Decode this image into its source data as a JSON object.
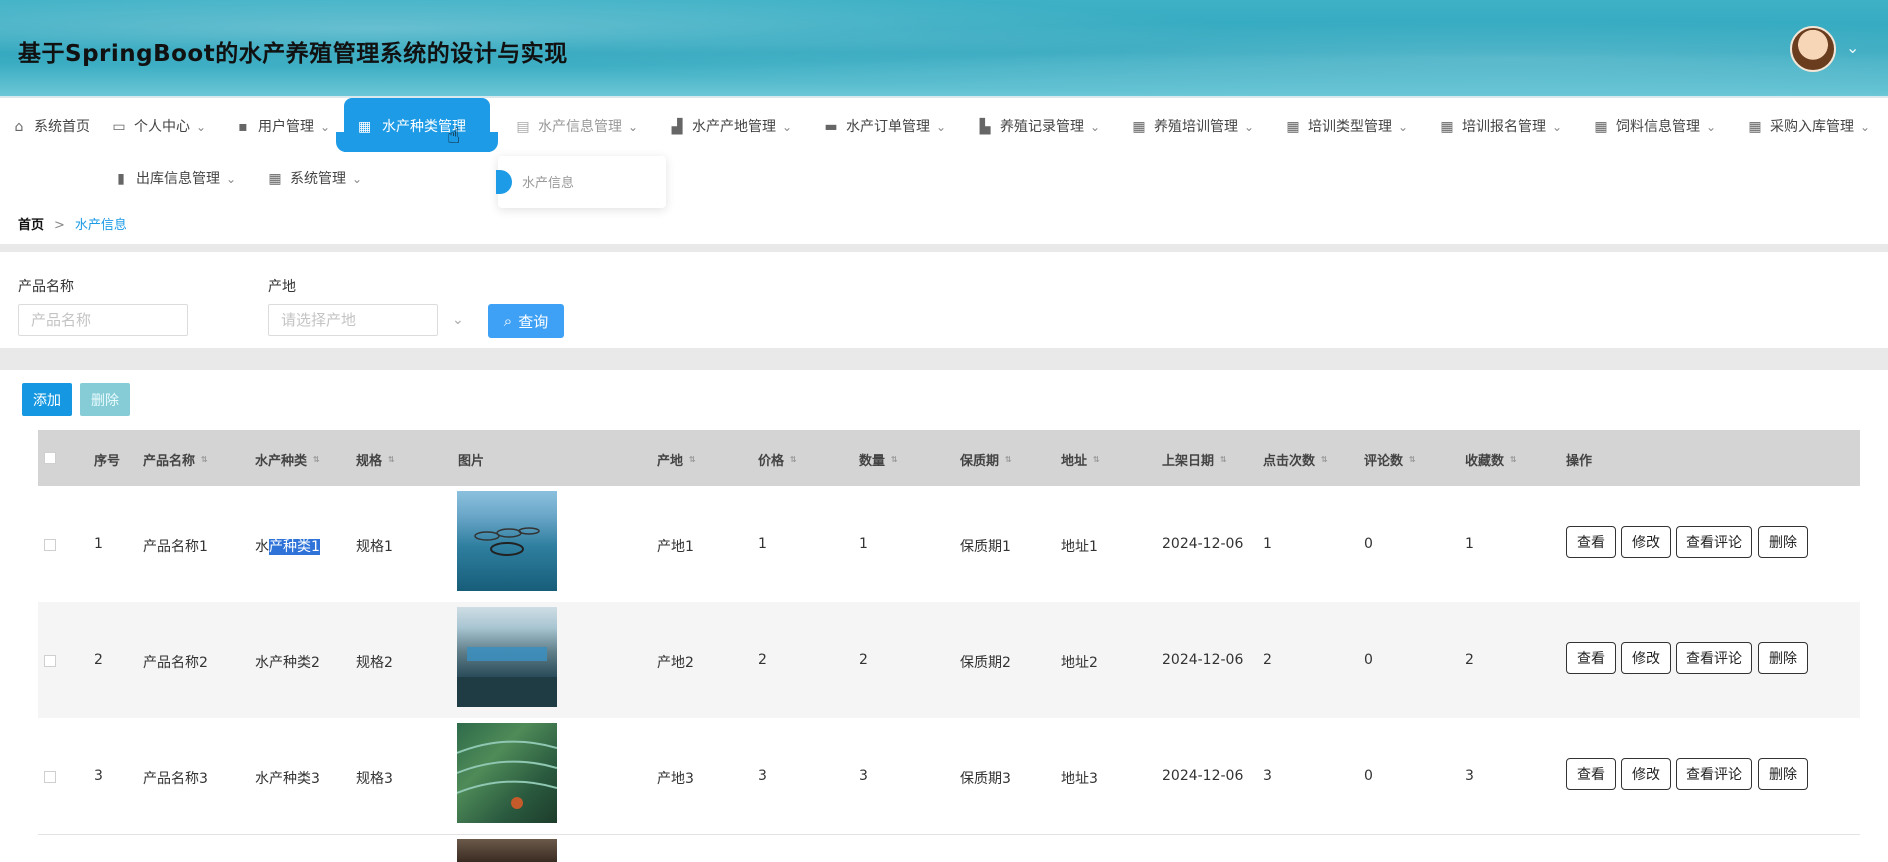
{
  "app": {
    "title": "基于SpringBoot的水产养殖管理系统的设计与实现",
    "user_menu_caret": "⌄"
  },
  "nav": {
    "items": [
      {
        "label": "系统首页",
        "icon": "home-icon"
      },
      {
        "label": "个人中心",
        "icon": "profile-icon"
      },
      {
        "label": "用户管理",
        "icon": "chat-icon"
      },
      {
        "label": "水产种类管理",
        "icon": "grid-icon",
        "active": true
      },
      {
        "label": "水产信息管理",
        "icon": "clipboard-icon"
      },
      {
        "label": "水产产地管理",
        "icon": "factory-icon"
      },
      {
        "label": "水产订单管理",
        "icon": "briefcase-icon"
      },
      {
        "label": "养殖记录管理",
        "icon": "building-icon"
      },
      {
        "label": "养殖培训管理",
        "icon": "grid-icon"
      },
      {
        "label": "培训类型管理",
        "icon": "grid-icon"
      },
      {
        "label": "培训报名管理",
        "icon": "grid-icon"
      },
      {
        "label": "饲料信息管理",
        "icon": "grid-icon"
      },
      {
        "label": "采购入库管理",
        "icon": "grid-icon"
      },
      {
        "label": "出库信息管理",
        "icon": "bar-chart-icon"
      },
      {
        "label": "系统管理",
        "icon": "grid-icon"
      }
    ],
    "dropdown_item": "水产信息"
  },
  "breadcrumb": {
    "home": "首页",
    "separator": ">",
    "current": "水产信息"
  },
  "search": {
    "name_label": "产品名称",
    "name_placeholder": "产品名称",
    "origin_label": "产地",
    "origin_placeholder": "请选择产地",
    "query_button": "查询"
  },
  "actions": {
    "add": "添加",
    "delete": "删除"
  },
  "table": {
    "headers": [
      "序号",
      "产品名称",
      "水产种类",
      "规格",
      "图片",
      "产地",
      "价格",
      "数量",
      "保质期",
      "地址",
      "上架日期",
      "点击次数",
      "评论数",
      "收藏数",
      "操作"
    ],
    "row_actions": [
      "查看",
      "修改",
      "查看评论",
      "删除"
    ],
    "rows": [
      {
        "index": "1",
        "name": "产品名称1",
        "category_a": "水",
        "category_b": "产种类1",
        "spec": "规格1",
        "origin": "产地1",
        "price": "1",
        "qty": "1",
        "shelf": "保质期1",
        "address": "地址1",
        "date": "2024-12-06",
        "clicks": "1",
        "comments": "0",
        "favorites": "1"
      },
      {
        "index": "2",
        "name": "产品名称2",
        "category": "水产种类2",
        "spec": "规格2",
        "origin": "产地2",
        "price": "2",
        "qty": "2",
        "shelf": "保质期2",
        "address": "地址2",
        "date": "2024-12-06",
        "clicks": "2",
        "comments": "0",
        "favorites": "2"
      },
      {
        "index": "3",
        "name": "产品名称3",
        "category": "水产种类3",
        "spec": "规格3",
        "origin": "产地3",
        "price": "3",
        "qty": "3",
        "shelf": "保质期3",
        "address": "地址3",
        "date": "2024-12-06",
        "clicks": "3",
        "comments": "0",
        "favorites": "3"
      }
    ]
  },
  "colors": {
    "accent": "#1e9be6",
    "query_button": "#3fa1f5",
    "add_button": "#1598e1",
    "delete_button": "#86ccd6",
    "table_header": "#d4d4d4",
    "selection": "#2f73d8"
  }
}
